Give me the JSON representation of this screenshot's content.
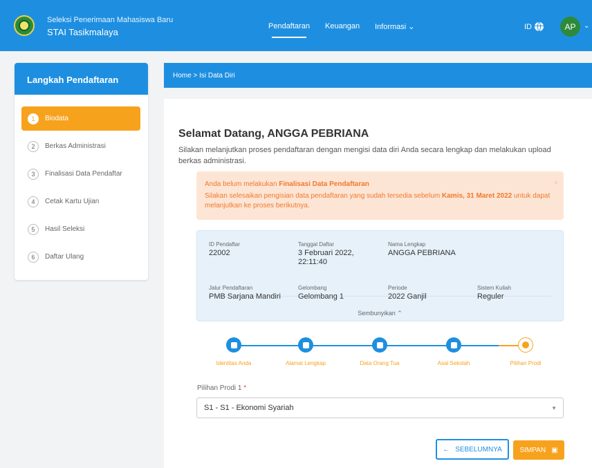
{
  "header": {
    "subtitle": "Seleksi Penerimaan Mahasiswa Baru",
    "title": "STAI Tasikmalaya",
    "nav": [
      {
        "label": "Pendaftaran",
        "active": true
      },
      {
        "label": "Keuangan",
        "active": false
      },
      {
        "label": "Informasi ⌄",
        "active": false
      }
    ],
    "language": "ID",
    "avatar_initials": "AP",
    "accent": "#1e8fe0"
  },
  "sidebar": {
    "title": "Langkah Pendaftaran",
    "steps": [
      {
        "num": "1",
        "label": "Biodata",
        "active": true
      },
      {
        "num": "2",
        "label": "Berkas Administrasi"
      },
      {
        "num": "3",
        "label": "Finalisasi Data Pendaftar"
      },
      {
        "num": "4",
        "label": "Cetak Kartu Ujian"
      },
      {
        "num": "5",
        "label": "Hasil Seleksi"
      },
      {
        "num": "6",
        "label": "Daftar Ulang"
      }
    ]
  },
  "breadcrumb": "Home  >  Isi Data Diri",
  "main": {
    "welcome": "Selamat Datang, ANGGA PEBRIANA",
    "intro": "Silakan melanjutkan proses pendaftaran dengan mengisi data diri Anda secara lengkap dan melakukan upload berkas administrasi.",
    "alert": {
      "line1_prefix": "Anda belum melakukan ",
      "line1_bold": "Finalisasi Data Pendaftaran",
      "line2_prefix": "Silakan selesaikan pengisian data pendaftaran yang sudah tersedia sebelum ",
      "line2_bold": "Kamis, 31 Maret 2022",
      "line2_suffix": " untuk dapat melanjutkan ke proses berikutnya.",
      "close": "×"
    },
    "info": {
      "id_label": "ID Pendaftar",
      "id_value": "22002",
      "tgl_label": "Tanggal Daftar",
      "tgl_value_1": "3 Februari 2022,",
      "tgl_value_2": "22:11:40",
      "nama_label": "Nama Lengkap",
      "nama_value": "ANGGA PEBRIANA",
      "jalur_label": "Jalur Pendaftaran",
      "jalur_value": "PMB Sarjana Mandiri",
      "gel_label": "Gelombang",
      "gel_value": "Gelombang 1",
      "periode_label": "Periode",
      "periode_value": "2022 Ganjil",
      "sistem_label": "Sistem Kuliah",
      "sistem_value": "Reguler",
      "toggle": "Sembunyikan ⌃"
    },
    "stepper": [
      "Identitas Anda",
      "Alamat Lengkap",
      "Data Orang Tua",
      "Asal Sekolah",
      "Pilihan Prodi"
    ],
    "field_label": "Pilihan Prodi 1",
    "field_required": "*",
    "select_value": "S1 - S1 - Ekonomi Syariah",
    "back_label": "SEBELUMNYA",
    "save_label": "SIMPAN"
  }
}
